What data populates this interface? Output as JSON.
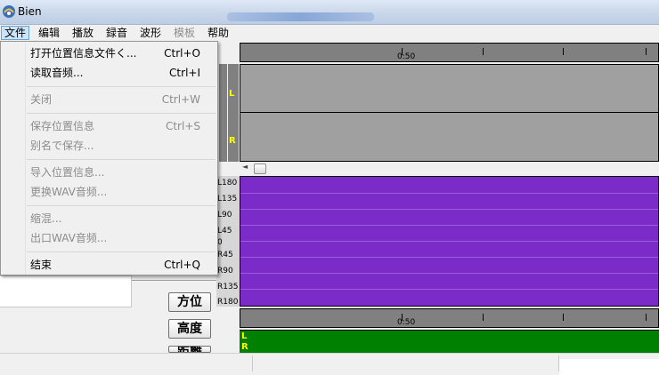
{
  "window": {
    "title": "Bien"
  },
  "menubar": {
    "items": [
      {
        "label": "文件",
        "state": "active"
      },
      {
        "label": "编辑",
        "state": "normal"
      },
      {
        "label": "播放",
        "state": "normal"
      },
      {
        "label": "録音",
        "state": "normal"
      },
      {
        "label": "波形",
        "state": "normal"
      },
      {
        "label": "模板",
        "state": "disabled"
      },
      {
        "label": "帮助",
        "state": "normal"
      }
    ]
  },
  "file_menu": {
    "items": [
      {
        "label": "打开位置信息文件く...",
        "shortcut": "Ctrl+O",
        "enabled": true
      },
      {
        "label": "读取音频...",
        "shortcut": "Ctrl+I",
        "enabled": true
      },
      {
        "label": "关闭",
        "shortcut": "Ctrl+W",
        "enabled": false
      },
      {
        "label": "保存位置信息",
        "shortcut": "Ctrl+S",
        "enabled": false
      },
      {
        "label": "别名で保存...",
        "shortcut": "",
        "enabled": false
      },
      {
        "label": "导入位置信息...",
        "shortcut": "",
        "enabled": false
      },
      {
        "label": "更换WAV音频...",
        "shortcut": "",
        "enabled": false
      },
      {
        "label": "缩混...",
        "shortcut": "",
        "enabled": false
      },
      {
        "label": "出口WAV音频...",
        "shortcut": "",
        "enabled": false
      },
      {
        "label": "结束",
        "shortcut": "Ctrl+Q",
        "enabled": true
      }
    ]
  },
  "timeline": {
    "top_ruler_label": "0:50",
    "bottom_ruler_label": "0:50"
  },
  "channels": {
    "left": "L",
    "right": "R"
  },
  "pan_scale": {
    "labels": [
      "L180",
      "L135",
      "L90",
      "L45",
      "0",
      "R45",
      "R90",
      "R135",
      "R180"
    ]
  },
  "buttons": {
    "direction": "方位",
    "height": "高度",
    "distance": "距離"
  },
  "colors": {
    "pan_panel": "#7b2bc8",
    "level_panel": "#008000",
    "channel_label": "#ffff00",
    "waveform_bg": "#a0a0a0"
  },
  "icons": {
    "app": "app-icon"
  }
}
